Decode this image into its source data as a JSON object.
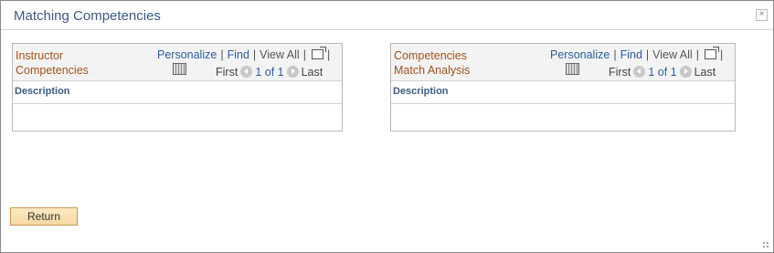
{
  "window": {
    "title": "Matching Competencies",
    "close_label": "×"
  },
  "left_grid": {
    "title": "Instructor Competencies",
    "personalize": "Personalize",
    "find": "Find",
    "view_all": "View All",
    "separator": "|",
    "first": "First",
    "page_range": "1 of 1",
    "last": "Last",
    "column_header": "Description"
  },
  "right_grid": {
    "title": "Competencies Match Analysis",
    "personalize": "Personalize",
    "find": "Find",
    "view_all": "View All",
    "separator": "|",
    "first": "First",
    "page_range": "1 of 1",
    "last": "Last",
    "column_header": "Description"
  },
  "footer": {
    "return_label": "Return"
  },
  "colors": {
    "title_text": "#3a5a86",
    "grid_title_text": "#a0521e",
    "link_text": "#2a5ea0",
    "button_bg": "#f6d8a2"
  }
}
